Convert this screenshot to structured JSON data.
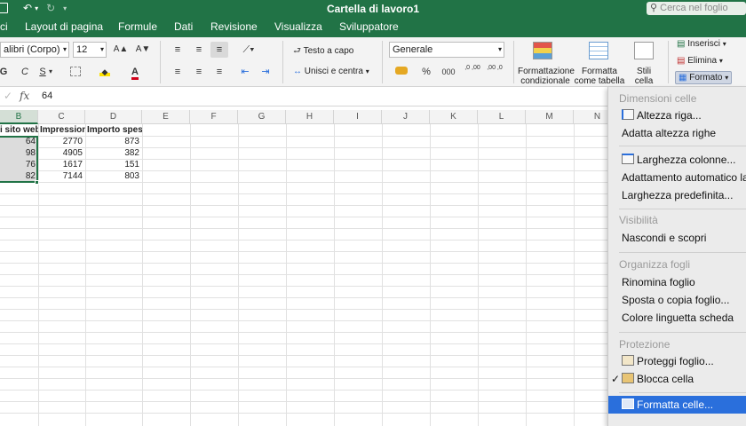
{
  "app": {
    "title": "Cartella di lavoro1",
    "search_placeholder": "Cerca nel foglio"
  },
  "tabs": [
    "ci",
    "Layout di pagina",
    "Formule",
    "Dati",
    "Revisione",
    "Visualizza",
    "Sviluppatore"
  ],
  "ribbon": {
    "font_name": "alibri (Corpo)",
    "font_size": "12",
    "grow_font": "A▲",
    "shrink_font": "A▼",
    "wrap_text": "Testo a capo",
    "merge_center": "Unisci e centra",
    "number_format": "Generale",
    "percent": "%",
    "thousands": "000",
    "inc_decimal": ",0 ,00",
    "dec_decimal": ",00 ,0",
    "cond_format": [
      "Formattazione",
      "condizionale"
    ],
    "format_table": [
      "Formatta",
      "come tabella"
    ],
    "cell_styles": [
      "Stili",
      "cella"
    ],
    "insert": "Inserisci",
    "delete": "Elimina",
    "format": "Formato",
    "bold": "G",
    "italic": "C",
    "underline": "S",
    "font_color_letter": "A"
  },
  "formula_bar": {
    "fx": "fx",
    "value": "64"
  },
  "columns": [
    "B",
    "C",
    "D",
    "E",
    "F",
    "G",
    "H",
    "I",
    "J",
    "K",
    "L",
    "M",
    "N"
  ],
  "table": {
    "headers": [
      "i sito web",
      "Impressioni",
      "Importo speso"
    ],
    "rows": [
      [
        "64",
        "2770",
        "873"
      ],
      [
        "98",
        "4905",
        "382"
      ],
      [
        "76",
        "1617",
        "151"
      ],
      [
        "82",
        "7144",
        "803"
      ]
    ]
  },
  "menu": {
    "section_dimensions": "Dimensioni celle",
    "row_height": "Altezza riga...",
    "autofit_rows": "Adatta altezza righe",
    "col_width": "Larghezza colonne...",
    "autofit_cols": "Adattamento automatico la",
    "default_width": "Larghezza predefinita...",
    "section_visibility": "Visibilità",
    "hide_unhide": "Nascondi e scopri",
    "section_organize": "Organizza fogli",
    "rename_sheet": "Rinomina foglio",
    "move_copy": "Sposta o copia foglio...",
    "tab_color": "Colore linguetta scheda",
    "section_protection": "Protezione",
    "protect_sheet": "Proteggi foglio...",
    "lock_cell": "Blocca cella",
    "format_cells": "Formatta celle...",
    "checkmark": "✓"
  },
  "colors": {
    "brand": "#217346",
    "highlight": "#2a6fdc",
    "font_color": "#d0021b",
    "fill_color": "#ffe200"
  }
}
